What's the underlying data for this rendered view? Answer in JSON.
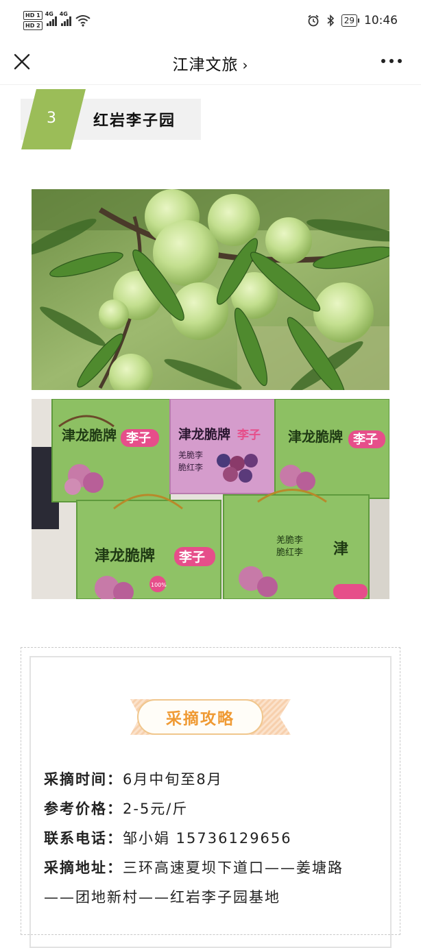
{
  "status_bar": {
    "sim1": "HD 1",
    "sim2": "HD 2",
    "net1": "4G",
    "net2": "4G",
    "battery": "29",
    "time": "10:46"
  },
  "navbar": {
    "title": "江津文旅",
    "chevron": "›",
    "close_icon": "close-icon",
    "more_icon": "more-icon"
  },
  "section": {
    "number": "3",
    "title": "红岩李子园"
  },
  "photos": {
    "plum_tree": "plum-tree-photo",
    "gift_boxes": {
      "brand": "津龙脆牌",
      "product": "李子",
      "variety_1": "羌脆李",
      "variety_2": "脆红李",
      "badge": "100%"
    }
  },
  "guide": {
    "heading": "采摘攻略",
    "time_label": "采摘时间：",
    "time_value": "6月中旬至8月",
    "price_label": "参考价格：",
    "price_value": "2-5元/斤",
    "phone_label": "联系电话：",
    "phone_value": "邹小娟 15736129656",
    "address_label": "采摘地址：",
    "address_line1": "三环高速夏坝下道口——姜塘路",
    "address_line2": "——团地新村——红岩李子园基地"
  },
  "colors": {
    "section_accent": "#9bbd58",
    "guide_accent": "#ef9a34",
    "ribbon": "#f0c68c"
  }
}
